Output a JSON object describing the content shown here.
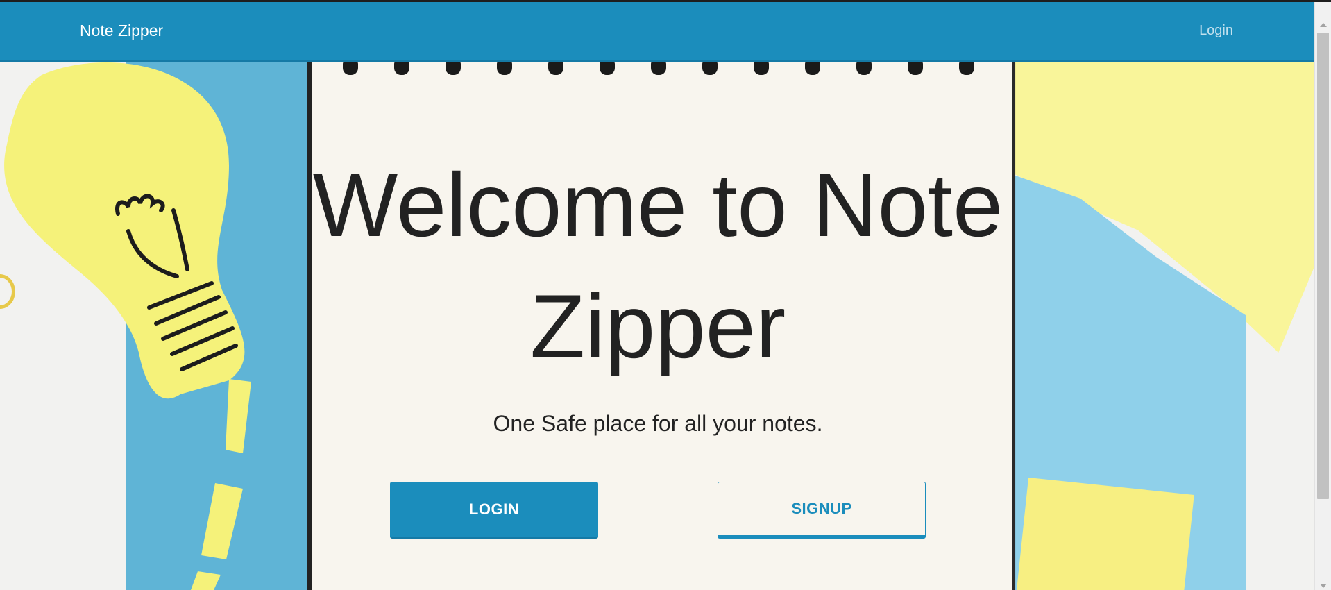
{
  "navbar": {
    "brand": "Note Zipper",
    "login_link": "Login"
  },
  "hero": {
    "title": "Welcome to Note Zipper",
    "subtitle": "One Safe place for all your notes."
  },
  "buttons": {
    "login": "LOGIN",
    "signup": "SIGNUP"
  },
  "colors": {
    "primary": "#1b8dbc",
    "text": "#222222",
    "background_paper": "#f8f5ee"
  },
  "icons": {
    "decorative": "lightbulb-illustration"
  }
}
